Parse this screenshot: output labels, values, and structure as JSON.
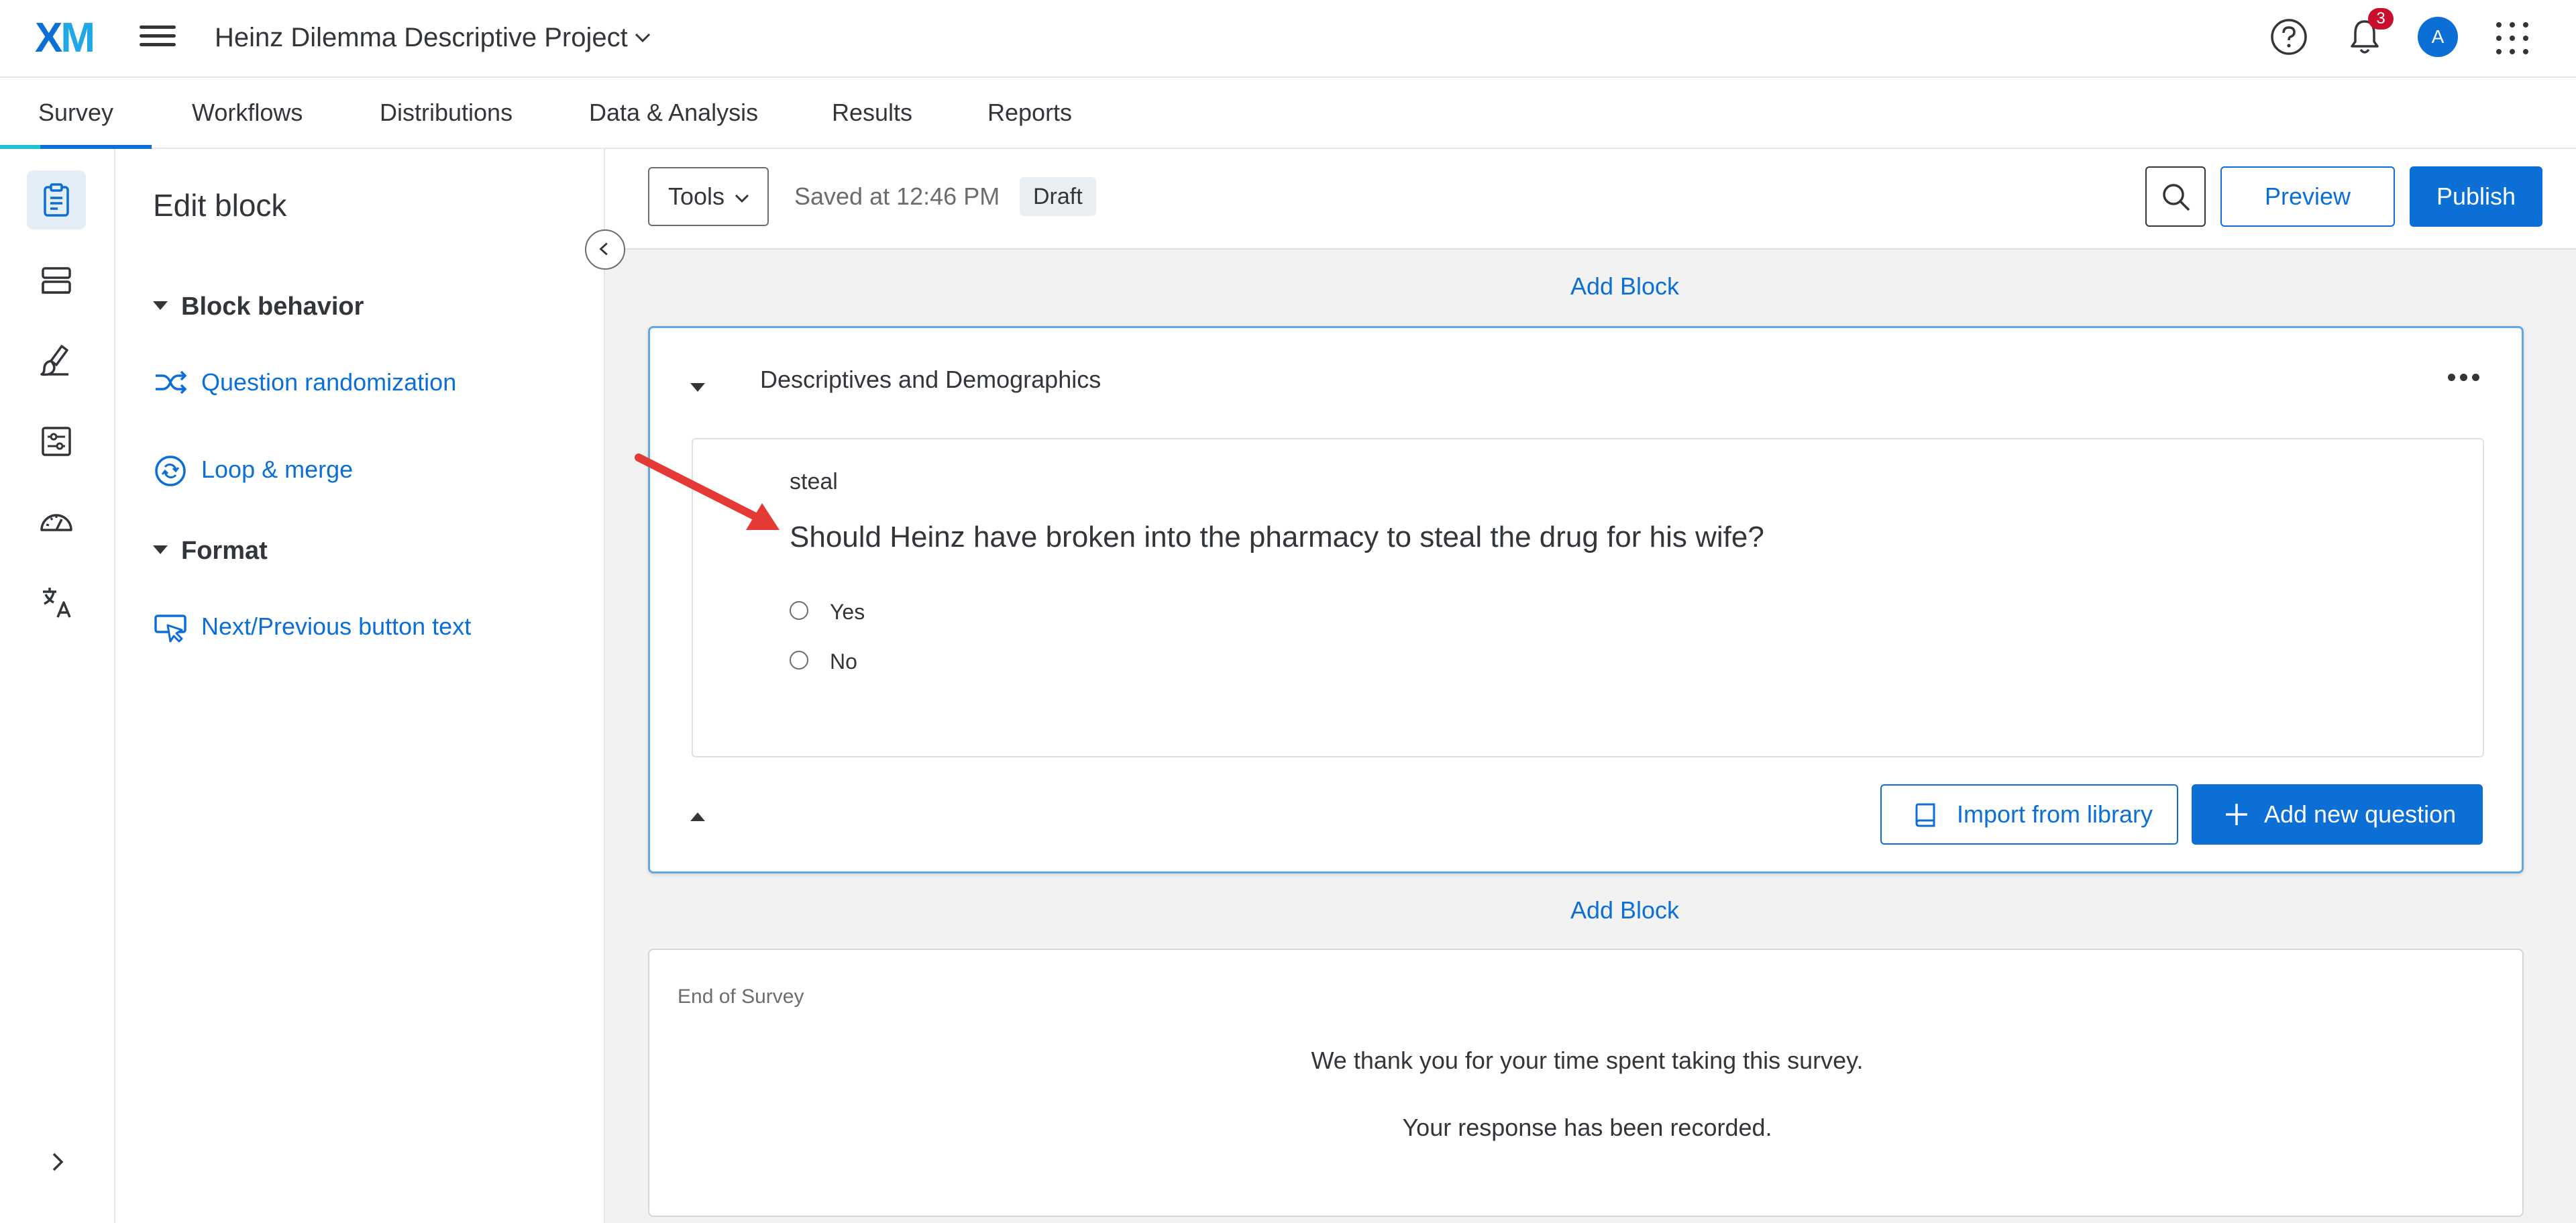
{
  "header": {
    "logo_x": "X",
    "logo_m": "M",
    "project_title": "Heinz Dilemma Descriptive Project",
    "notification_count": "3",
    "avatar_initial": "A"
  },
  "nav_tabs": [
    "Survey",
    "Workflows",
    "Distributions",
    "Data & Analysis",
    "Results",
    "Reports"
  ],
  "edit_panel": {
    "title": "Edit block",
    "block_behavior": "Block behavior",
    "question_randomization": "Question randomization",
    "loop_merge": "Loop & merge",
    "format": "Format",
    "next_previous": "Next/Previous button text"
  },
  "toolbar": {
    "tools_label": "Tools",
    "saved_text": "Saved at 12:46 PM",
    "draft_badge": "Draft",
    "preview_label": "Preview",
    "publish_label": "Publish"
  },
  "add_block_label": "Add Block",
  "block": {
    "title": "Descriptives and Demographics",
    "question": {
      "id": "steal",
      "text": "Should Heinz have broken into the pharmacy to steal the drug for his wife?",
      "choices": [
        "Yes",
        "No"
      ]
    },
    "import_label": "Import from library",
    "add_question_label": "Add new question"
  },
  "end_of_survey": {
    "label": "End of Survey",
    "message_1": "We thank you for your time spent taking this survey.",
    "message_2": "Your response has been recorded."
  },
  "colors": {
    "accent": "#0b6fd6",
    "accent_light": "#20a7e6",
    "block_border": "#5fa8e8",
    "badge_red": "#c8102e",
    "annotation_arrow": "#e53935"
  }
}
